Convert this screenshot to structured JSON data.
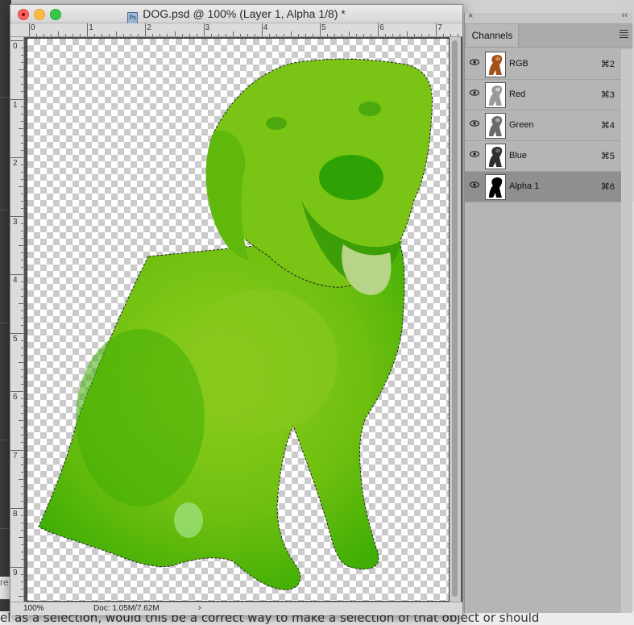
{
  "document": {
    "title": "DOG.psd @ 100% (Layer 1, Alpha 1/8) *",
    "file_icon": "photoshop-document-icon",
    "zoom": "100%",
    "doc_info": "Doc: 1.05M/7.62M",
    "status_arrow": "›",
    "ruler_h_labels": [
      "0",
      "1",
      "2",
      "3",
      "4",
      "5",
      "6",
      "7"
    ],
    "ruler_v_labels": [
      "0",
      "1",
      "2",
      "3",
      "4",
      "5",
      "6",
      "7",
      "8",
      "9"
    ],
    "quick_mask_color": "#6fbf10",
    "selection": "marching-ants"
  },
  "panel": {
    "close_glyph": "×",
    "collapse_glyph": "‹‹",
    "tab": "Channels",
    "channels": [
      {
        "label": "RGB",
        "shortcut": "⌘2",
        "thumb": "color",
        "selected": false
      },
      {
        "label": "Red",
        "shortcut": "⌘3",
        "thumb": "gray-light",
        "selected": false
      },
      {
        "label": "Green",
        "shortcut": "⌘4",
        "thumb": "gray-mid",
        "selected": false
      },
      {
        "label": "Blue",
        "shortcut": "⌘5",
        "thumb": "gray-dark",
        "selected": false
      },
      {
        "label": "Alpha 1",
        "shortcut": "⌘6",
        "thumb": "mask",
        "selected": true
      }
    ]
  },
  "background_page": {
    "bottom_text": "el as a selection, would this be a correct way to make a selection of that object or should",
    "left_fragment": "re"
  }
}
